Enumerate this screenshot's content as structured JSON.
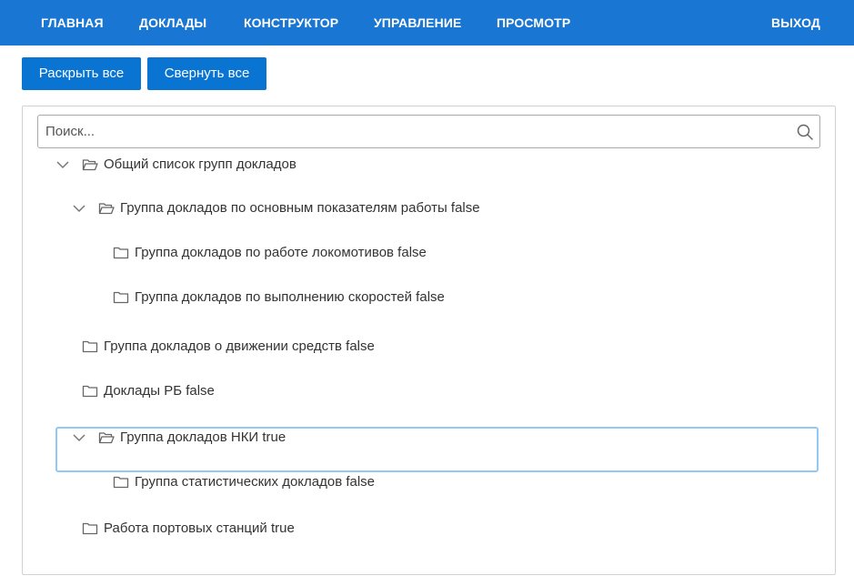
{
  "nav": {
    "items": [
      "ГЛАВНАЯ",
      "ДОКЛАДЫ",
      "КОНСТРУКТОР",
      "УПРАВЛЕНИЕ",
      "ПРОСМОТР"
    ],
    "logout": "ВЫХОД"
  },
  "toolbar": {
    "expand_all": "Раскрыть все",
    "collapse_all": "Свернуть все"
  },
  "search": {
    "placeholder": "Поиск...",
    "value": ""
  },
  "tree": [
    {
      "label": "Общий список групп докладов",
      "level": 0,
      "expanded": true,
      "selected": false
    },
    {
      "label": "Группа докладов по основным показателям работы false",
      "level": 1,
      "expanded": true,
      "selected": false
    },
    {
      "label": "Группа докладов по работе локомотивов false",
      "level": 2,
      "expanded": false,
      "selected": false
    },
    {
      "label": "Группа докладов по выполнению скоростей false",
      "level": 2,
      "expanded": false,
      "selected": false
    },
    {
      "label": "Группа докладов о движении средств false",
      "level": 1,
      "expanded": false,
      "selected": false
    },
    {
      "label": "Доклады РБ false",
      "level": 1,
      "expanded": false,
      "selected": false
    },
    {
      "label": "Группа докладов НКИ true",
      "level": 1,
      "expanded": true,
      "selected": true
    },
    {
      "label": "Группа статистических докладов false",
      "level": 2,
      "expanded": false,
      "selected": false
    },
    {
      "label": "Работа портовых станций true",
      "level": 1,
      "expanded": false,
      "selected": false
    }
  ],
  "colors": {
    "navbar": "#1976d2",
    "button": "#0a74d2",
    "selection_border": "#90c8f6"
  }
}
